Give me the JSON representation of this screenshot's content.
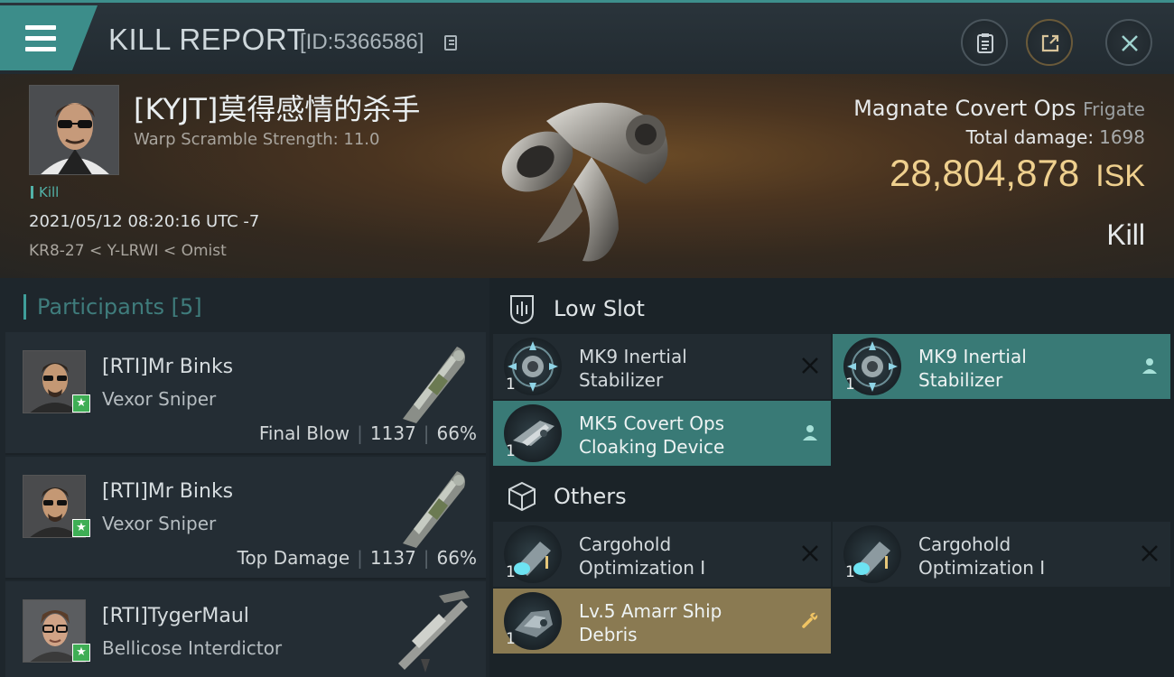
{
  "header": {
    "title": "KILL REPORT",
    "kill_id": "[ID:5366586]"
  },
  "victim": {
    "name": "[KYJT]莫得感情的杀手",
    "warp_scramble": "Warp Scramble Strength: 11.0",
    "tag": "Kill",
    "timestamp": "2021/05/12 08:20:16 UTC -7",
    "route": "KR8-27 < Y-LRWI < Omist",
    "ship_name": "Magnate Covert Ops",
    "ship_class": "Frigate",
    "total_damage_label": "Total damage:",
    "total_damage": "1698",
    "isk_value": "28,804,878",
    "isk_unit": "ISK",
    "result": "Kill"
  },
  "participants": {
    "label": "Participants",
    "count": "[5]",
    "items": [
      {
        "name": "[RTI]Mr Binks",
        "ship": "Vexor Sniper",
        "role": "Final Blow",
        "damage": "1137",
        "percent": "66%"
      },
      {
        "name": "[RTI]Mr Binks",
        "ship": "Vexor Sniper",
        "role": "Top Damage",
        "damage": "1137",
        "percent": "66%"
      },
      {
        "name": "[RTI]TygerMaul",
        "ship": "Bellicose Interdictor",
        "role": "",
        "damage": "",
        "percent": ""
      }
    ]
  },
  "low_slot": {
    "title": "Low Slot",
    "items": [
      {
        "name_line1": "MK9 Inertial",
        "name_line2": "Stabilizer",
        "qty": "1",
        "status": "destroyed",
        "action_icon": "close-icon"
      },
      {
        "name_line1": "MK9 Inertial",
        "name_line2": "Stabilizer",
        "qty": "1",
        "status": "dropped",
        "action_icon": "person-icon"
      },
      {
        "name_line1": "MK5 Covert Ops",
        "name_line2": "Cloaking Device",
        "qty": "1",
        "status": "dropped",
        "action_icon": "person-icon"
      }
    ]
  },
  "others": {
    "title": "Others",
    "items": [
      {
        "name_line1": "Cargohold",
        "name_line2": "Optimization I",
        "qty": "1",
        "status": "destroyed",
        "action_icon": "close-icon"
      },
      {
        "name_line1": "Cargohold",
        "name_line2": "Optimization I",
        "qty": "1",
        "status": "destroyed",
        "action_icon": "close-icon"
      },
      {
        "name_line1": "Lv.5 Amarr Ship",
        "name_line2": "Debris",
        "qty": "1",
        "status": "salvage",
        "action_icon": "wrench-icon"
      }
    ]
  },
  "colors": {
    "accent_teal": "#3c8d8a",
    "isk_gold": "#efd08e",
    "salvage_gold": "#8a7a52",
    "star_green": "#3fae55"
  }
}
